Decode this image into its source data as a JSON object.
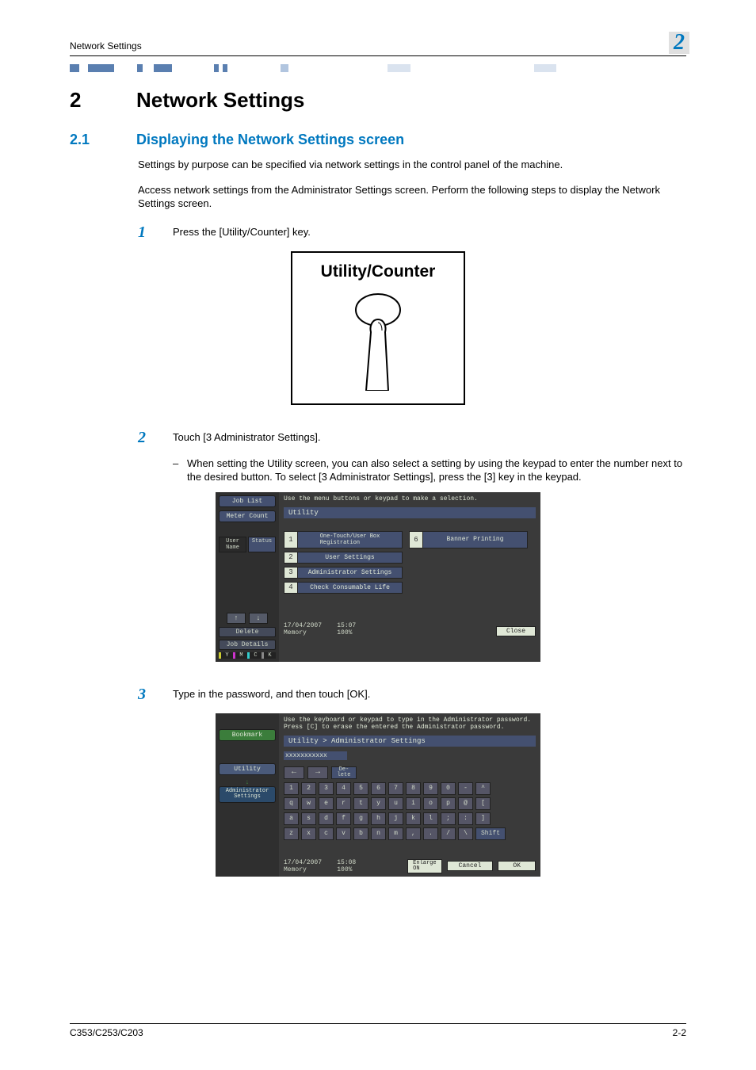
{
  "running_head": {
    "left": "Network Settings",
    "right": "2"
  },
  "chapter": {
    "num": "2",
    "title": "Network Settings"
  },
  "section": {
    "num": "2.1",
    "title": "Displaying the Network Settings screen"
  },
  "para1": "Settings by purpose can be specified via network settings in the control panel of the machine.",
  "para2": "Access network settings from the Administrator Settings screen. Perform the following steps to display the Network Settings screen.",
  "step1": {
    "num": "1",
    "text": "Press the [Utility/Counter] key."
  },
  "util_label": "Utility/Counter",
  "step2": {
    "num": "2",
    "text": "Touch [3 Administrator Settings]."
  },
  "bullet2": "When setting the Utility screen, you can also select a setting by using the keypad to enter the number next to the desired button. To select [3 Administrator Settings], press the [3] key in the keypad.",
  "panel1": {
    "left": {
      "job_list": "Job List",
      "meter_count": "Meter Count",
      "user_name": "User\nName",
      "status": "Status",
      "up": "↑",
      "down": "↓",
      "delete": "Delete",
      "job_details": "Job Details",
      "cmyk": [
        "Y",
        "M",
        "C",
        "K"
      ]
    },
    "right": {
      "hint": "Use the menu buttons or keypad to make a selection.",
      "title_bar": "Utility",
      "items": [
        {
          "n": "1",
          "label": "One-Touch/User Box\nRegistration"
        },
        {
          "n": "2",
          "label": "User Settings"
        },
        {
          "n": "3",
          "label": "Administrator Settings"
        },
        {
          "n": "4",
          "label": "Check Consumable Life"
        }
      ],
      "item6": {
        "n": "6",
        "label": "Banner Printing"
      },
      "date": "17/04/2007",
      "time": "15:07",
      "memory": "Memory",
      "mem_pct": "100%",
      "close": "Close"
    }
  },
  "step3": {
    "num": "3",
    "text": "Type in the password, and then touch [OK]."
  },
  "panel2": {
    "left": {
      "bookmark": "Bookmark",
      "utility": "Utility",
      "admin": "Administrator\nSettings"
    },
    "right": {
      "hint1": "Use the keyboard or keypad to type in the Administrator password.",
      "hint2": "Press [C] to erase the entered the Administrator password.",
      "title_bar": "Utility > Administrator Settings",
      "field": "xxxxxxxxxxx",
      "arrow_left": "←",
      "arrow_right": "→",
      "delete": "De-\nlete",
      "row1": [
        "1",
        "2",
        "3",
        "4",
        "5",
        "6",
        "7",
        "8",
        "9",
        "0",
        "-",
        "^"
      ],
      "row2": [
        "q",
        "w",
        "e",
        "r",
        "t",
        "y",
        "u",
        "i",
        "o",
        "p",
        "@",
        "["
      ],
      "row3": [
        "a",
        "s",
        "d",
        "f",
        "g",
        "h",
        "j",
        "k",
        "l",
        ";",
        ":",
        "]"
      ],
      "row4": [
        "z",
        "x",
        "c",
        "v",
        "b",
        "n",
        "m",
        ",",
        ".",
        "/",
        "\\"
      ],
      "shift": "Shift",
      "date": "17/04/2007",
      "time": "15:08",
      "memory": "Memory",
      "mem_pct": "100%",
      "enlarge": "Enlarge\nON",
      "cancel": "Cancel",
      "ok": "OK"
    }
  },
  "footer": {
    "left": "C353/C253/C203",
    "right": "2-2"
  }
}
